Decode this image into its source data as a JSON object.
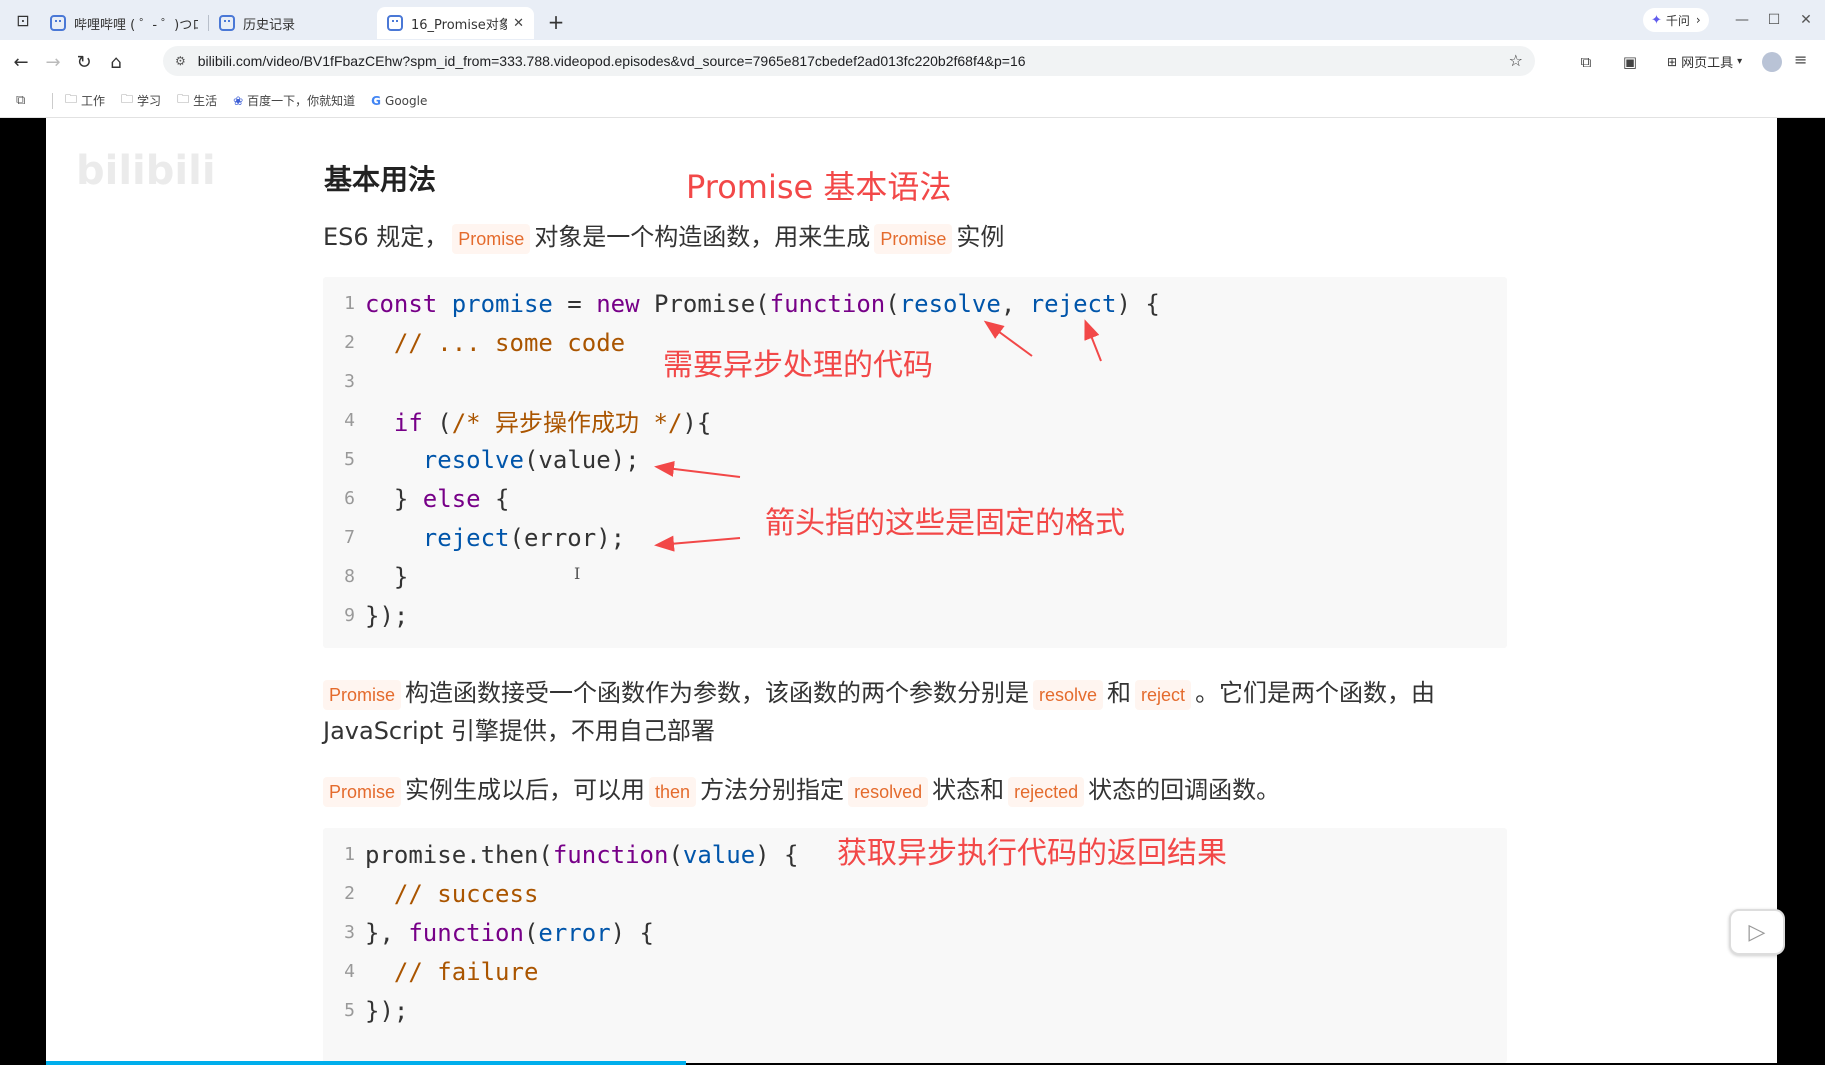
{
  "browser": {
    "tabs": [
      {
        "title": "哔哩哔哩 ( ゜- ゜)つロ",
        "active": false
      },
      {
        "title": "历史记录",
        "active": false
      },
      {
        "title": "16_Promise对象_",
        "active": true
      }
    ],
    "qianwen_label": "千问",
    "url": "bilibili.com/video/BV1fFbazCEhw?spm_id_from=333.788.videopod.episodes&vd_source=7965e817cbedef2ad013fc220b2f68f4&p=16",
    "webtools_label": "网页工具",
    "bookmarks": [
      {
        "label": "工作",
        "icon": "folder-icon"
      },
      {
        "label": "学习",
        "icon": "folder-icon"
      },
      {
        "label": "生活",
        "icon": "folder-icon"
      },
      {
        "label": "百度一下，你就知道",
        "icon": "baidu-icon"
      },
      {
        "label": "Google",
        "icon": "google-icon"
      }
    ]
  },
  "slide": {
    "watermark": "bilibili",
    "heading": "基本用法",
    "red_title": "Promise 基本语法",
    "intro": {
      "pre": "ES6 规定，",
      "code1": "Promise",
      "mid": "对象是一个构造函数，用来生成",
      "code2": "Promise",
      "post": "实例"
    },
    "code1_lines": [
      "1",
      "2",
      "3",
      "4",
      "5",
      "6",
      "7",
      "8",
      "9"
    ],
    "code1_text": {
      "l1_const": "const",
      "l1_promise": "promise",
      "l1_eq": " = ",
      "l1_new": "new",
      "l1_Promise": " Promise(",
      "l1_function": "function",
      "l1_paren": "(",
      "l1_resolve": "resolve",
      "l1_comma": ", ",
      "l1_reject": "reject",
      "l1_end": ") {",
      "l2": "  // ... some code",
      "l4_if": "  if",
      "l4_rest1": " (",
      "l4_comment": "/* 异步操作成功 */",
      "l4_rest2": "){",
      "l5_resolve": "    resolve",
      "l5_rest": "(value);",
      "l6_brace": "  } ",
      "l6_else": "else",
      "l6_rest": " {",
      "l7_reject": "    reject",
      "l7_rest": "(error);",
      "l8": "  }",
      "l9": "});"
    },
    "anno_async": "需要异步处理的代码",
    "anno_fixed": "箭头指的这些是固定的格式",
    "para2": {
      "code1": "Promise",
      "t1": "构造函数接受一个函数作为参数，该函数的两个参数分别是",
      "code2": "resolve",
      "t2": "和",
      "code3": "reject",
      "t3": "。它们是两个函数，由",
      "line2": "JavaScript 引擎提供，不用自己部署"
    },
    "para3": {
      "code1": "Promise",
      "t1": "实例生成以后，可以用",
      "code2": "then",
      "t2": "方法分别指定",
      "code3": "resolved",
      "t3": "状态和",
      "code4": "rejected",
      "t4": "状态的回调函数。"
    },
    "code2_lines": [
      "1",
      "2",
      "3",
      "4",
      "5"
    ],
    "code2_text": {
      "l1_a": "promise.then(",
      "l1_function": "function",
      "l1_b": "(",
      "l1_value": "value",
      "l1_c": ") {",
      "l2": "  // success",
      "l3_a": "}, ",
      "l3_function": "function",
      "l3_b": "(",
      "l3_error": "error",
      "l3_c": ") {",
      "l4": "  // failure",
      "l5": "});"
    },
    "anno_result": "获取异步执行代码的返回结果"
  },
  "video": {
    "progress_fraction": 0.37
  },
  "colors": {
    "annotation_red": "#f24848",
    "inline_code": "#e46b2d",
    "keyword": "#770088",
    "def": "#0055aa",
    "variable": "#0000cc",
    "comment": "#aa5500",
    "progress": "#00aeec"
  }
}
